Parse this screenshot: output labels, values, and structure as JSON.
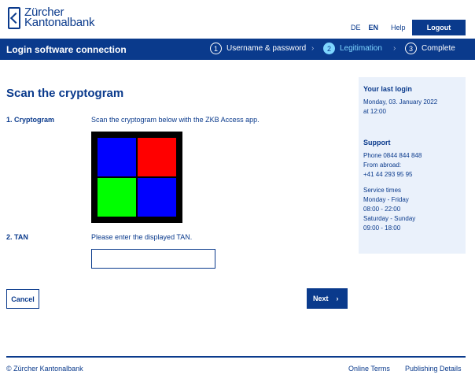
{
  "header": {
    "logo_line1": "Zürcher",
    "logo_line2": "Kantonalbank",
    "lang_de": "DE",
    "lang_en": "EN",
    "help": "Help",
    "logout": "Logout"
  },
  "band": {
    "title": "Login software connection",
    "steps": [
      {
        "num": "1",
        "label": "Username & password",
        "active": false
      },
      {
        "num": "2",
        "label": "Legitimation",
        "active": true
      },
      {
        "num": "3",
        "label": "Complete",
        "active": false
      }
    ],
    "separator": "›"
  },
  "main": {
    "title": "Scan the cryptogram",
    "cryptogram_label": "1. Cryptogram",
    "cryptogram_text": "Scan the cryptogram below with the ZKB Access app.",
    "cryptogram_colors": [
      "#0000ff",
      "#ff0000",
      "#00ff00",
      "#0000ff"
    ],
    "tan_label": "2. TAN",
    "tan_text": "Please enter the displayed TAN.",
    "tan_value": "",
    "cancel": "Cancel",
    "next": "Next",
    "next_chevron": "›"
  },
  "sidebar": {
    "last_login_title": "Your last login",
    "last_login_date": "Monday, 03. January 2022",
    "last_login_time": "at 12:00",
    "support_title": "Support",
    "phone": "Phone 0844 844 848",
    "abroad_label": "From abroad:",
    "abroad_phone": "+41 44 293 95 95",
    "service_title": "Service times",
    "weekday": "Monday - Friday",
    "weekday_hours": "08:00 - 22:00",
    "weekend": "Saturday - Sunday",
    "weekend_hours": "09:00 - 18:00"
  },
  "footer": {
    "copyright": "© Zürcher Kantonalbank",
    "online_terms": "Online Terms",
    "publishing": "Publishing Details"
  },
  "colors": {
    "brand": "#0a3a8c",
    "active_step": "#7fd6ff",
    "sidebar_bg": "#eaf1fb"
  }
}
